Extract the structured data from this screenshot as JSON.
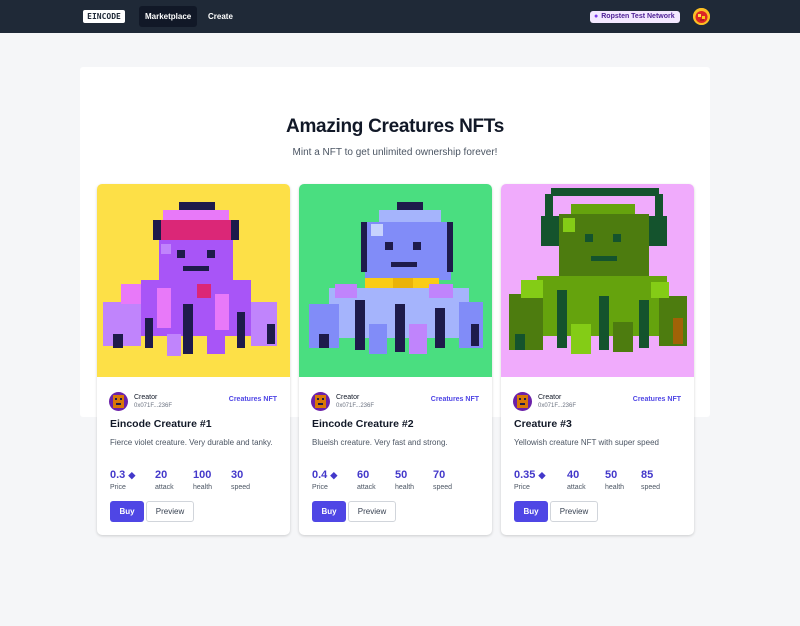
{
  "nav": {
    "logo_text": "EINCODE",
    "links": [
      "Marketplace",
      "Create"
    ],
    "network_label": "Ropsten Test Network",
    "network_dot": "●"
  },
  "hero": {
    "title": "Amazing Creatures NFTs",
    "subtitle": "Mint a NFT to get unlimited ownership forever!"
  },
  "stat_labels": {
    "price": "Price",
    "attack": "attack",
    "health": "health",
    "speed": "speed"
  },
  "buttons": {
    "buy": "Buy",
    "preview": "Preview"
  },
  "cards": [
    {
      "creator_label": "Creator",
      "creator_address": "0x071F...236F",
      "collection": "Creatures NFT",
      "name": "Eincode Creature #1",
      "description": "Fierce violet creature. Very durable and tanky.",
      "price": "0.3",
      "attack": "20",
      "health": "100",
      "speed": "30",
      "bg_color": "#fde047"
    },
    {
      "creator_label": "Creator",
      "creator_address": "0x071F...236F",
      "collection": "Creatures NFT",
      "name": "Eincode Creature #2",
      "description": "Blueish creature. Very fast and strong.",
      "price": "0.4",
      "attack": "60",
      "health": "50",
      "speed": "70",
      "bg_color": "#4ade80"
    },
    {
      "creator_label": "Creator",
      "creator_address": "0x071F...236F",
      "collection": "Creatures NFT",
      "name": "Creature #3",
      "description": "Yellowish creature NFT with super speed",
      "price": "0.35",
      "attack": "40",
      "health": "50",
      "speed": "85",
      "bg_color": "#f0abfc"
    }
  ],
  "colors": {
    "nav_bg": "#1f2937",
    "accent": "#4f46e5",
    "stat_value": "#4338ca"
  }
}
